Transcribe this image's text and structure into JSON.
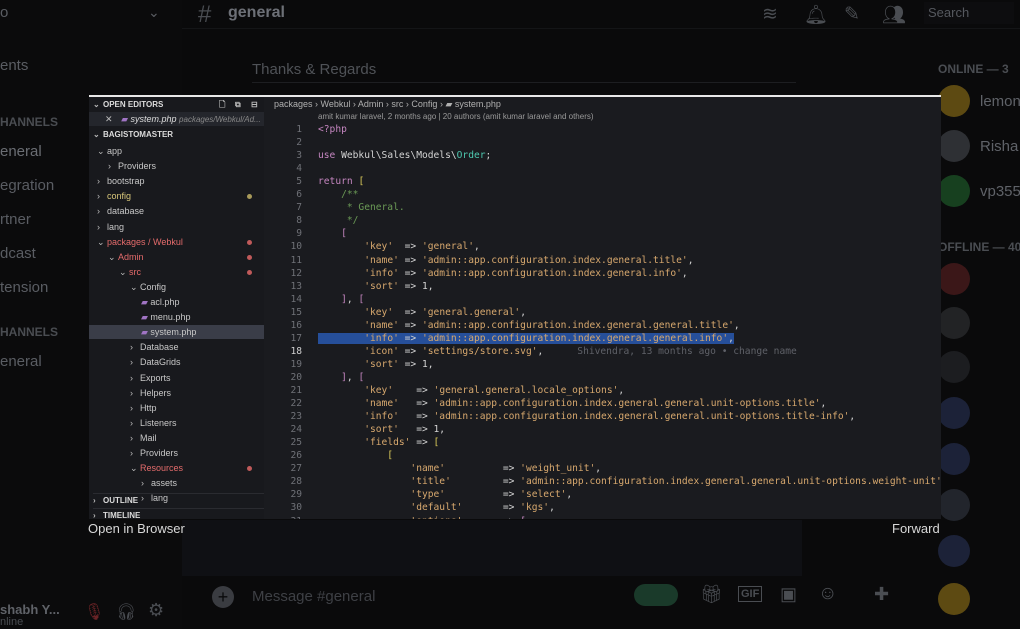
{
  "background": {
    "left_items": [
      "ents",
      "eneral",
      "egration",
      "rtner",
      "dcast",
      "tension",
      "eneral"
    ],
    "left_cats": [
      "HANNELS",
      "HANNELS"
    ],
    "channel_title": "general",
    "search_placeholder": "Search",
    "thanks": "Thanks & Regards",
    "online_header": "ONLINE — 3",
    "offline_header": "OFFLINE — 40",
    "members": [
      "lemon",
      "Risha",
      "vp355"
    ],
    "message_placeholder": "Message #general",
    "user_name": "shabh Y...",
    "user_status": "nline"
  },
  "viewer": {
    "open_in_browser": "Open in Browser",
    "forward": "Forward"
  },
  "vscode": {
    "open_editors_label": "OPEN EDITORS",
    "open_file": "system.php",
    "open_file_path": "packages/Webkul/Ad...",
    "project_label": "BAGISTOMASTER",
    "tree": [
      {
        "label": "app",
        "depth": 0,
        "open": true
      },
      {
        "label": "Providers",
        "depth": 1,
        "open": false
      },
      {
        "label": "bootstrap",
        "depth": 0,
        "open": false
      },
      {
        "label": "config",
        "depth": 0,
        "open": false,
        "status": "yellow"
      },
      {
        "label": "database",
        "depth": 0,
        "open": false
      },
      {
        "label": "lang",
        "depth": 0,
        "open": false
      },
      {
        "label": "packages / Webkul",
        "depth": 0,
        "open": true,
        "status": "red"
      },
      {
        "label": "Admin",
        "depth": 1,
        "open": true,
        "status": "red"
      },
      {
        "label": "src",
        "depth": 2,
        "open": true,
        "status": "red"
      },
      {
        "label": "Config",
        "depth": 3,
        "open": true
      },
      {
        "label": "acl.php",
        "depth": 4,
        "file": true
      },
      {
        "label": "menu.php",
        "depth": 4,
        "file": true
      },
      {
        "label": "system.php",
        "depth": 4,
        "file": true,
        "selected": true
      },
      {
        "label": "Database",
        "depth": 3,
        "open": false
      },
      {
        "label": "DataGrids",
        "depth": 3,
        "open": false
      },
      {
        "label": "Exports",
        "depth": 3,
        "open": false
      },
      {
        "label": "Helpers",
        "depth": 3,
        "open": false
      },
      {
        "label": "Http",
        "depth": 3,
        "open": false
      },
      {
        "label": "Listeners",
        "depth": 3,
        "open": false
      },
      {
        "label": "Mail",
        "depth": 3,
        "open": false
      },
      {
        "label": "Providers",
        "depth": 3,
        "open": false
      },
      {
        "label": "Resources",
        "depth": 3,
        "open": true,
        "status": "red"
      },
      {
        "label": "assets",
        "depth": 4,
        "open": false
      },
      {
        "label": "lang",
        "depth": 4,
        "open": false
      }
    ],
    "outline_label": "OUTLINE",
    "timeline_label": "TIMELINE",
    "breadcrumb": [
      "packages",
      "Webkul",
      "Admin",
      "src",
      "Config",
      "system.php"
    ],
    "blame": "amit kumar laravel, 2 months ago | 20 authors (amit kumar laravel and others)",
    "inline_blame": "Shivendra, 13 months ago • change name",
    "highlight_line": 17,
    "current_line": 18,
    "code": [
      [
        {
          "t": "<?php",
          "c": "kw"
        }
      ],
      [],
      [
        {
          "t": "use ",
          "c": "kw"
        },
        {
          "t": "Webkul\\Sales\\Models\\",
          "c": "op"
        },
        {
          "t": "Order",
          "c": "cls"
        },
        {
          "t": ";",
          "c": "op"
        }
      ],
      [],
      [
        {
          "t": "return ",
          "c": "kw"
        },
        {
          "t": "[",
          "c": "br2"
        }
      ],
      [
        {
          "t": "    /**",
          "c": "cm"
        }
      ],
      [
        {
          "t": "     * General.",
          "c": "cm"
        }
      ],
      [
        {
          "t": "     */",
          "c": "cm"
        }
      ],
      [
        {
          "t": "    [",
          "c": "br"
        }
      ],
      [
        {
          "t": "        ",
          "c": "op"
        },
        {
          "t": "'key'",
          "c": "str"
        },
        {
          "t": "  => ",
          "c": "op"
        },
        {
          "t": "'general'",
          "c": "str"
        },
        {
          "t": ",",
          "c": "op"
        }
      ],
      [
        {
          "t": "        ",
          "c": "op"
        },
        {
          "t": "'name'",
          "c": "str"
        },
        {
          "t": " => ",
          "c": "op"
        },
        {
          "t": "'admin::app.configuration.index.general.title'",
          "c": "str"
        },
        {
          "t": ",",
          "c": "op"
        }
      ],
      [
        {
          "t": "        ",
          "c": "op"
        },
        {
          "t": "'info'",
          "c": "str"
        },
        {
          "t": " => ",
          "c": "op"
        },
        {
          "t": "'admin::app.configuration.index.general.info'",
          "c": "str"
        },
        {
          "t": ",",
          "c": "op"
        }
      ],
      [
        {
          "t": "        ",
          "c": "op"
        },
        {
          "t": "'sort'",
          "c": "str"
        },
        {
          "t": " => 1,",
          "c": "op"
        }
      ],
      [
        {
          "t": "    ]",
          "c": "br"
        },
        {
          "t": ", ",
          "c": "op"
        },
        {
          "t": "[",
          "c": "br"
        }
      ],
      [
        {
          "t": "        ",
          "c": "op"
        },
        {
          "t": "'key'",
          "c": "str"
        },
        {
          "t": "  => ",
          "c": "op"
        },
        {
          "t": "'general.general'",
          "c": "str"
        },
        {
          "t": ",",
          "c": "op"
        }
      ],
      [
        {
          "t": "        ",
          "c": "op"
        },
        {
          "t": "'name'",
          "c": "str"
        },
        {
          "t": " => ",
          "c": "op"
        },
        {
          "t": "'admin::app.configuration.index.general.general.title'",
          "c": "str"
        },
        {
          "t": ",",
          "c": "op"
        }
      ],
      [
        {
          "t": "        ",
          "c": "op"
        },
        {
          "t": "'info'",
          "c": "str"
        },
        {
          "t": " => ",
          "c": "op"
        },
        {
          "t": "'admin::app.configuration.index.general.general.info'",
          "c": "str"
        },
        {
          "t": ",",
          "c": "op"
        }
      ],
      [
        {
          "t": "        ",
          "c": "op"
        },
        {
          "t": "'icon'",
          "c": "str"
        },
        {
          "t": " => ",
          "c": "op"
        },
        {
          "t": "'settings/store.svg'",
          "c": "str"
        },
        {
          "t": ",",
          "c": "op"
        }
      ],
      [
        {
          "t": "        ",
          "c": "op"
        },
        {
          "t": "'sort'",
          "c": "str"
        },
        {
          "t": " => 1,",
          "c": "op"
        }
      ],
      [
        {
          "t": "    ]",
          "c": "br"
        },
        {
          "t": ", ",
          "c": "op"
        },
        {
          "t": "[",
          "c": "br"
        }
      ],
      [
        {
          "t": "        ",
          "c": "op"
        },
        {
          "t": "'key'",
          "c": "str"
        },
        {
          "t": "    => ",
          "c": "op"
        },
        {
          "t": "'general.general.locale_options'",
          "c": "str"
        },
        {
          "t": ",",
          "c": "op"
        }
      ],
      [
        {
          "t": "        ",
          "c": "op"
        },
        {
          "t": "'name'",
          "c": "str"
        },
        {
          "t": "   => ",
          "c": "op"
        },
        {
          "t": "'admin::app.configuration.index.general.general.unit-options.title'",
          "c": "str"
        },
        {
          "t": ",",
          "c": "op"
        }
      ],
      [
        {
          "t": "        ",
          "c": "op"
        },
        {
          "t": "'info'",
          "c": "str"
        },
        {
          "t": "   => ",
          "c": "op"
        },
        {
          "t": "'admin::app.configuration.index.general.general.unit-options.title-info'",
          "c": "str"
        },
        {
          "t": ",",
          "c": "op"
        }
      ],
      [
        {
          "t": "        ",
          "c": "op"
        },
        {
          "t": "'sort'",
          "c": "str"
        },
        {
          "t": "   => 1,",
          "c": "op"
        }
      ],
      [
        {
          "t": "        ",
          "c": "op"
        },
        {
          "t": "'fields'",
          "c": "str"
        },
        {
          "t": " => ",
          "c": "op"
        },
        {
          "t": "[",
          "c": "br2"
        }
      ],
      [
        {
          "t": "            [",
          "c": "br2"
        }
      ],
      [
        {
          "t": "                ",
          "c": "op"
        },
        {
          "t": "'name'",
          "c": "str"
        },
        {
          "t": "          => ",
          "c": "op"
        },
        {
          "t": "'weight_unit'",
          "c": "str"
        },
        {
          "t": ",",
          "c": "op"
        }
      ],
      [
        {
          "t": "                ",
          "c": "op"
        },
        {
          "t": "'title'",
          "c": "str"
        },
        {
          "t": "         => ",
          "c": "op"
        },
        {
          "t": "'admin::app.configuration.index.general.general.unit-options.weight-unit'",
          "c": "str"
        },
        {
          "t": ",",
          "c": "op"
        }
      ],
      [
        {
          "t": "                ",
          "c": "op"
        },
        {
          "t": "'type'",
          "c": "str"
        },
        {
          "t": "          => ",
          "c": "op"
        },
        {
          "t": "'select'",
          "c": "str"
        },
        {
          "t": ",",
          "c": "op"
        }
      ],
      [
        {
          "t": "                ",
          "c": "op"
        },
        {
          "t": "'default'",
          "c": "str"
        },
        {
          "t": "       => ",
          "c": "op"
        },
        {
          "t": "'kgs'",
          "c": "str"
        },
        {
          "t": ",",
          "c": "op"
        }
      ],
      [
        {
          "t": "                ",
          "c": "op"
        },
        {
          "t": "'options'",
          "c": "str"
        },
        {
          "t": "       => ",
          "c": "op"
        },
        {
          "t": "[",
          "c": "br"
        }
      ]
    ]
  }
}
